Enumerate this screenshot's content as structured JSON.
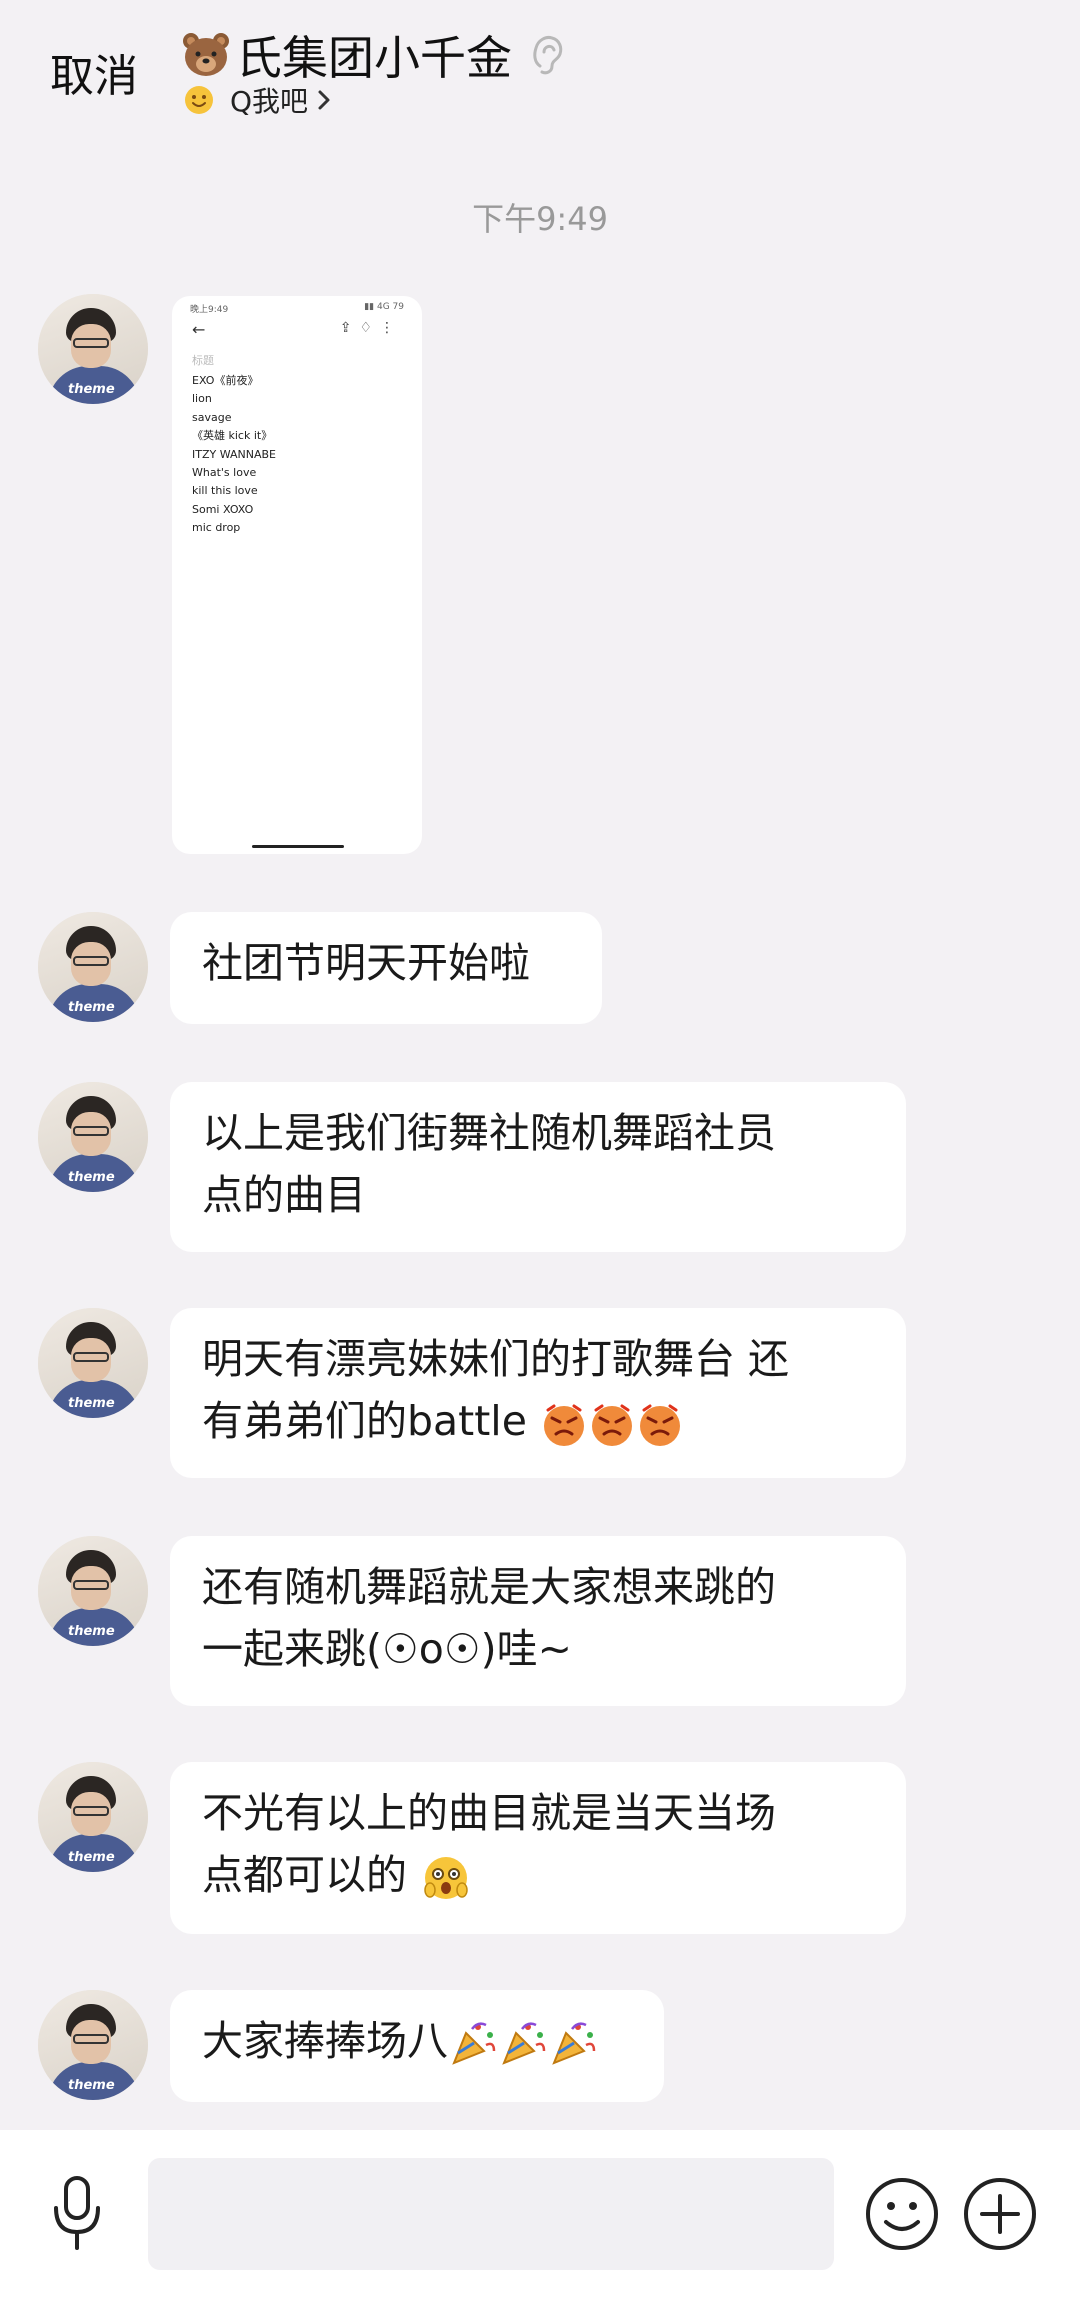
{
  "header": {
    "cancel_label": "取消",
    "title": "氏集团小千金",
    "subtitle": "Q我吧"
  },
  "chat": {
    "timestamp": "下午9:49",
    "avatar_tag": "theme",
    "image_message": {
      "status_left": "晚上9:49",
      "status_right": "▮▮ 4G 79",
      "note_title": "标题",
      "songs": [
        "EXO《前夜》",
        "lion",
        "savage",
        "《英雄 kick it》",
        "ITZY WANNABE",
        "What's love",
        "kill this love",
        "Somi XOXO",
        "mic drop"
      ]
    },
    "messages": [
      {
        "line1": "社团节明天开始啦",
        "line2": ""
      },
      {
        "line1": "以上是我们街舞社随机舞蹈社员",
        "line2": "点的曲目"
      },
      {
        "line1": "明天有漂亮妹妹们的打歌舞台 还",
        "line2": "有弟弟们的battle"
      },
      {
        "line1": "还有随机舞蹈就是大家想来跳的",
        "line2": "一起来跳(☉o☉)哇~"
      },
      {
        "line1": "不光有以上的曲目就是当天当场",
        "line2": "点都可以的"
      },
      {
        "line1": "大家捧捧场八",
        "line2": ""
      }
    ]
  },
  "icons": {
    "header": [
      "bear-icon",
      "ear-icon",
      "smile-icon",
      "chevron-right-icon"
    ],
    "bottom": [
      "microphone-icon",
      "emoji-icon",
      "plus-icon"
    ],
    "inline": [
      "angry-face-icon",
      "fearful-face-icon",
      "party-popper-icon"
    ]
  },
  "colors": {
    "background": "#f3f1f4",
    "bubble": "#ffffff",
    "timestamp": "#999999"
  }
}
